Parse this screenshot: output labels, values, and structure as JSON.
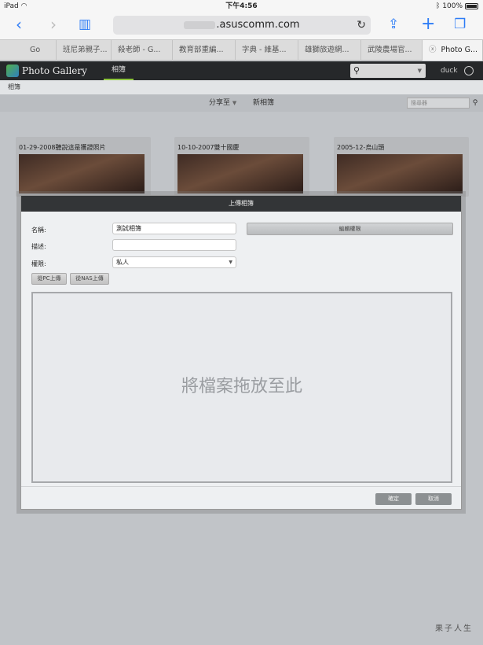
{
  "status_bar": {
    "device": "iPad",
    "wifi_icon": "wifi-icon",
    "time": "下午4:56",
    "bluetooth_icon": "bluetooth-icon",
    "battery": "100%"
  },
  "browser": {
    "url": ".asuscomm.com",
    "tabs": [
      {
        "label": "Go"
      },
      {
        "label": "班尼弟親子..."
      },
      {
        "label": "殺老師 - G..."
      },
      {
        "label": "教育部重編..."
      },
      {
        "label": "字典 - 維基..."
      },
      {
        "label": "雄獅旅遊網..."
      },
      {
        "label": "武陵農場官..."
      },
      {
        "label": "Photo G..."
      }
    ]
  },
  "app": {
    "title": "Photo Gallery",
    "nav_tab": "相簿",
    "user": "duck"
  },
  "breadcrumb": "相簿",
  "subbar": {
    "share": "分享至",
    "new_album": "新相簿",
    "search_placeholder": "搜尋器"
  },
  "albums": [
    {
      "title": "01-29-2008聽說這是獲證照片"
    },
    {
      "title": "10-10-2007雙十國慶"
    },
    {
      "title": "2005-12-烏山頭"
    }
  ],
  "modal": {
    "title": "上傳相簿",
    "name_label": "名稱:",
    "name_value": "測試相簿",
    "desc_label": "描述:",
    "desc_value": "",
    "perm_label": "權限:",
    "perm_value": "私人",
    "edit_perm": "編輯權限",
    "upload_pc": "從PC上傳",
    "upload_nas": "從NAS上傳",
    "drop_text": "將檔案拖放至此",
    "ok": "確定",
    "cancel": "取消"
  },
  "watermark": "果子人生"
}
